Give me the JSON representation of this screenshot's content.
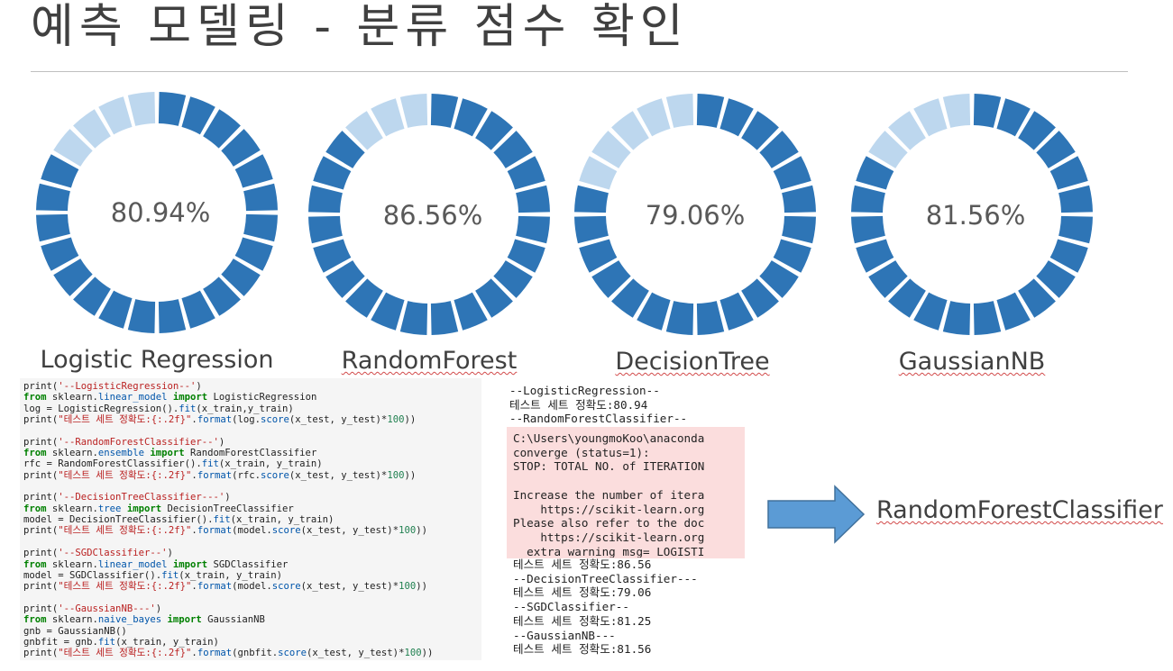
{
  "title": "예측 모델링 - 분류 점수 확인",
  "colors": {
    "segment_on": "#2e75b6",
    "segment_off": "#bdd7ee",
    "warn_bg": "#fbdddd",
    "arrow": "#5b9bd5"
  },
  "models": [
    {
      "name": "Logistic Regression",
      "accuracy_label": "80.94%",
      "accuracy": 80.94,
      "segments_total": 24,
      "segments_filled": 20
    },
    {
      "name": "RandomForest",
      "accuracy_label": "86.56%",
      "accuracy": 86.56,
      "segments_total": 24,
      "segments_filled": 21
    },
    {
      "name": "DecisionTree",
      "accuracy_label": "79.06%",
      "accuracy": 79.06,
      "segments_total": 24,
      "segments_filled": 19
    },
    {
      "name": "GaussianNB",
      "accuracy_label": "81.56%",
      "accuracy": 81.56,
      "segments_total": 24,
      "segments_filled": 20
    }
  ],
  "code_lines": [
    "print('--LogisticRegression--')",
    "from sklearn.linear_model import LogisticRegression",
    "log = LogisticRegression().fit(x_train,y_train)",
    "print(\"테스트 세트 정확도:{:.2f}\".format(log.score(x_test, y_test)*100))",
    "",
    "print('--RandomForestClassifier--')",
    "from sklearn.ensemble import RandomForestClassifier",
    "rfc = RandomForestClassifier().fit(x_train, y_train)",
    "print(\"테스트 세트 정확도:{:.2f}\".format(rfc.score(x_test, y_test)*100))",
    "",
    "print('--DecisionTreeClassifier---')",
    "from sklearn.tree import DecisionTreeClassifier",
    "model = DecisionTreeClassifier().fit(x_train, y_train)",
    "print(\"테스트 세트 정확도:{:.2f}\".format(model.score(x_test, y_test)*100))",
    "",
    "print('--SGDClassifier--')",
    "from sklearn.linear_model import SGDClassifier",
    "model = SGDClassifier().fit(x_train, y_train)",
    "print(\"테스트 세트 정확도:{:.2f}\".format(model.score(x_test, y_test)*100))",
    "",
    "print('--GaussianNB---')",
    "from sklearn.naive_bayes import GaussianNB",
    "gnb = GaussianNB()",
    "gnbfit = gnb.fit(x_train, y_train)",
    "print(\"테스트 세트 정확도:{:.2f}\".format(gnbfit.score(x_test, y_test)*100))"
  ],
  "output_top": [
    "--LogisticRegression--",
    "테스트 세트 정확도:80.94",
    "--RandomForestClassifier--"
  ],
  "warning_lines": [
    "C:\\Users\\youngmoKoo\\anaconda",
    "converge (status=1):",
    "STOP: TOTAL NO. of ITERATION",
    "",
    "Increase the number of itera",
    "    https://scikit-learn.org",
    "Please also refer to the doc",
    "    https://scikit-learn.org",
    "  extra_warning_msg=_LOGISTI"
  ],
  "output_bottom": [
    "테스트 세트 정확도:86.56",
    "--DecisionTreeClassifier---",
    "테스트 세트 정확도:79.06",
    "--SGDClassifier--",
    "테스트 세트 정확도:81.25",
    "--GaussianNB---",
    "테스트 세트 정확도:81.56"
  ],
  "best_model": "RandomForestClassifier"
}
